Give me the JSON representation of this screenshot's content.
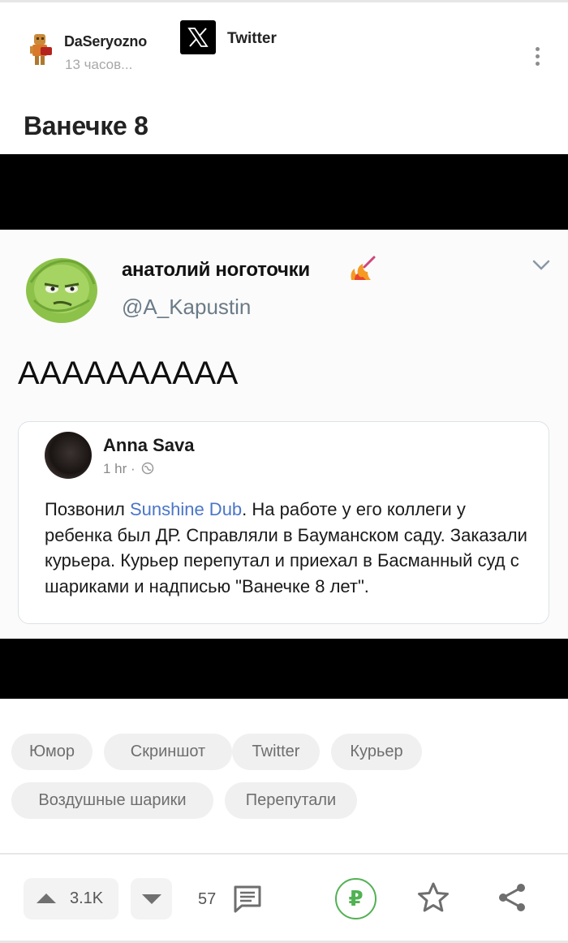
{
  "post": {
    "author": "DaSeryozno",
    "time": "13 часов...",
    "community": "Twitter",
    "title": "Ванечке 8"
  },
  "image": {
    "tweet_name": "анатолий ноготочки",
    "tweet_handle": "@A_Kapustin",
    "tweet_text": "АААААААААА",
    "quote": {
      "name": "Anna Sava",
      "meta": "1 hr ·",
      "text_before_link": "Позвонил ",
      "link": "Sunshine Dub",
      "text_after_link": ". На работе у его коллеги у ребенка был ДР. Справляли в Бауманском саду. Заказали курьера. Курьер перепутал и приехал в Басманный суд с шариками и надписью \"Ванечке 8 лет\"."
    }
  },
  "tags": [
    "Юмор",
    "Скриншот",
    "Twitter",
    "Курьер",
    "Воздушные шарики",
    "Перепутали"
  ],
  "footer": {
    "upvotes": "3.1K",
    "comments": "57",
    "donate_symbol": "₽"
  },
  "colors": {
    "accent_green": "#52b153",
    "tag_bg": "#f0f0f0",
    "link_blue": "#4a76c8"
  },
  "icons": {
    "menu": "kebab-icon",
    "upvote": "arrow-up-icon",
    "downvote": "arrow-down-icon",
    "comments": "comment-icon",
    "donate": "ruble-icon",
    "save": "star-icon",
    "share": "share-icon"
  }
}
